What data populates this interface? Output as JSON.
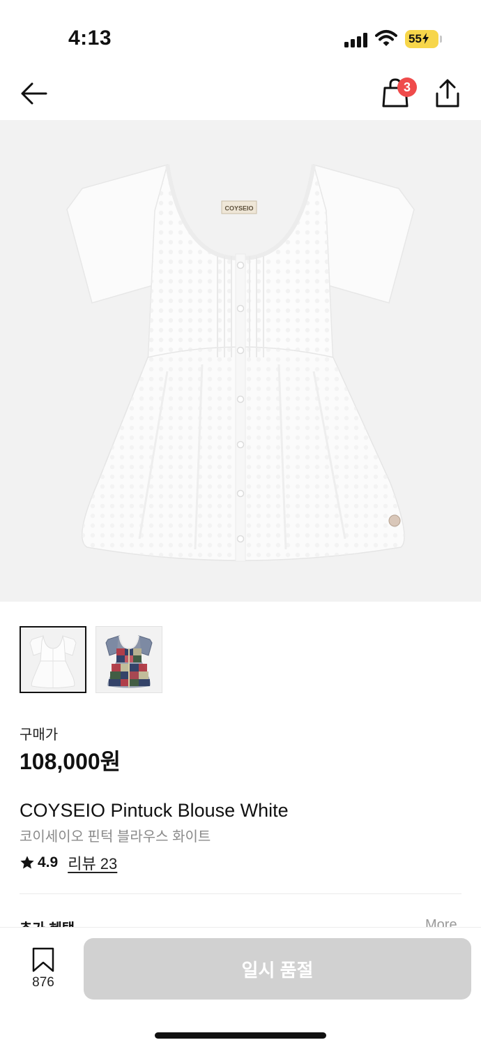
{
  "status_bar": {
    "time": "4:13",
    "battery": "55"
  },
  "nav": {
    "bag_badge": "3",
    "icons": [
      "arrow-left-icon",
      "shopping-bag-icon",
      "share-icon"
    ]
  },
  "product": {
    "brand_on_label": "COYSEIO",
    "price_label": "구매가",
    "price": "108,000원",
    "name_en": "COYSEIO Pintuck Blouse White",
    "name_ko": "코이세이오 핀턱 블라우스 화이트",
    "rating": "4.9",
    "review_link": "리뷰 23",
    "thumbnails": [
      "white",
      "check pattern"
    ]
  },
  "benefits_peek": {
    "title": "추가 혜택",
    "more": "More"
  },
  "bottom_bar": {
    "wish_count": "876",
    "soldout_label": "일시 품절"
  },
  "colors": {
    "badge": "#ef4b4b",
    "battery": "#f7d64a",
    "disabled_button": "#d1d1d1"
  }
}
